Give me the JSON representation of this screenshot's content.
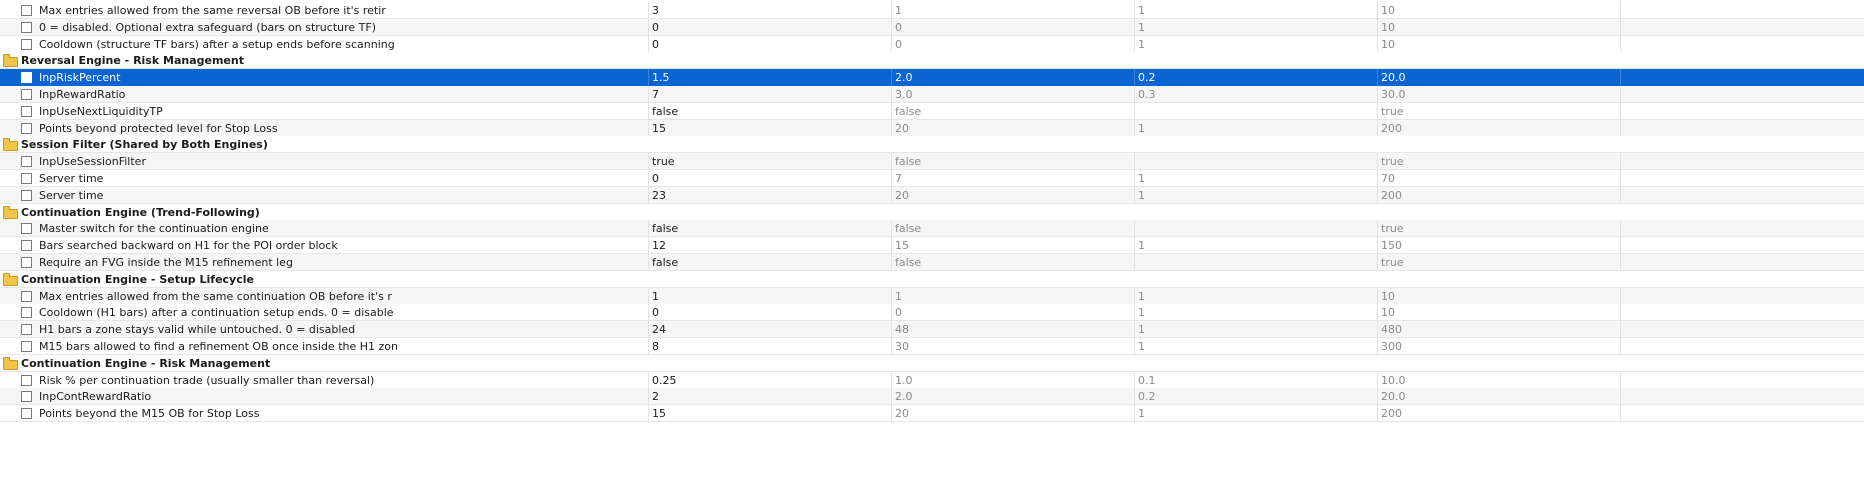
{
  "rows": [
    {
      "type": "param",
      "label": "Max entries allowed from the same reversal OB before it's retir",
      "value": "3",
      "start": "1",
      "step": "1",
      "stop": "10"
    },
    {
      "type": "param",
      "label": "0 = disabled. Optional extra safeguard (bars on structure TF)",
      "value": "0",
      "start": "0",
      "step": "1",
      "stop": "10"
    },
    {
      "type": "param",
      "label": "Cooldown (structure TF bars) after a setup ends before scanning",
      "value": "0",
      "start": "0",
      "step": "1",
      "stop": "10"
    },
    {
      "type": "group",
      "label": "Reversal Engine - Risk Management"
    },
    {
      "type": "param",
      "label": "InpRiskPercent",
      "value": "1.5",
      "start": "2.0",
      "step": "0.2",
      "stop": "20.0",
      "selected": true
    },
    {
      "type": "param",
      "label": "InpRewardRatio",
      "value": "7",
      "start": "3.0",
      "step": "0.3",
      "stop": "30.0"
    },
    {
      "type": "param",
      "label": "InpUseNextLiquidityTP",
      "value": "false",
      "start": "false",
      "step": "",
      "stop": "true"
    },
    {
      "type": "param",
      "label": "Points beyond protected level for Stop Loss",
      "value": "15",
      "start": "20",
      "step": "1",
      "stop": "200"
    },
    {
      "type": "group",
      "label": "Session Filter (Shared by Both Engines)"
    },
    {
      "type": "param",
      "label": "InpUseSessionFilter",
      "value": "true",
      "start": "false",
      "step": "",
      "stop": "true"
    },
    {
      "type": "param",
      "label": "Server time",
      "value": "0",
      "start": "7",
      "step": "1",
      "stop": "70"
    },
    {
      "type": "param",
      "label": "Server time",
      "value": "23",
      "start": "20",
      "step": "1",
      "stop": "200"
    },
    {
      "type": "group",
      "label": "Continuation Engine (Trend-Following)"
    },
    {
      "type": "param",
      "label": "Master switch for the continuation engine",
      "value": "false",
      "start": "false",
      "step": "",
      "stop": "true"
    },
    {
      "type": "param",
      "label": "Bars searched backward on H1 for the POI order block",
      "value": "12",
      "start": "15",
      "step": "1",
      "stop": "150"
    },
    {
      "type": "param",
      "label": "Require an FVG inside the M15 refinement leg",
      "value": "false",
      "start": "false",
      "step": "",
      "stop": "true"
    },
    {
      "type": "group",
      "label": "Continuation Engine - Setup Lifecycle"
    },
    {
      "type": "param",
      "label": "Max entries allowed from the same continuation OB before it's r",
      "value": "1",
      "start": "1",
      "step": "1",
      "stop": "10"
    },
    {
      "type": "param",
      "label": "Cooldown (H1 bars) after a continuation setup ends. 0 = disable",
      "value": "0",
      "start": "0",
      "step": "1",
      "stop": "10"
    },
    {
      "type": "param",
      "label": "H1 bars a zone stays valid while untouched. 0 = disabled",
      "value": "24",
      "start": "48",
      "step": "1",
      "stop": "480"
    },
    {
      "type": "param",
      "label": "M15 bars allowed to find a refinement OB once inside the H1 zon",
      "value": "8",
      "start": "30",
      "step": "1",
      "stop": "300"
    },
    {
      "type": "group",
      "label": "Continuation Engine - Risk Management"
    },
    {
      "type": "param",
      "label": "Risk % per continuation trade (usually smaller than reversal)",
      "value": "0.25",
      "start": "1.0",
      "step": "0.1",
      "stop": "10.0"
    },
    {
      "type": "param",
      "label": "InpContRewardRatio",
      "value": "2",
      "start": "2.0",
      "step": "0.2",
      "stop": "20.0"
    },
    {
      "type": "param",
      "label": "Points beyond the M15 OB for Stop Loss",
      "value": "15",
      "start": "20",
      "step": "1",
      "stop": "200"
    }
  ],
  "colors": {
    "selection": "#0a64d2",
    "folder": "#f3c44a"
  },
  "icons": {
    "group": "folder-icon",
    "param": "checkbox"
  }
}
